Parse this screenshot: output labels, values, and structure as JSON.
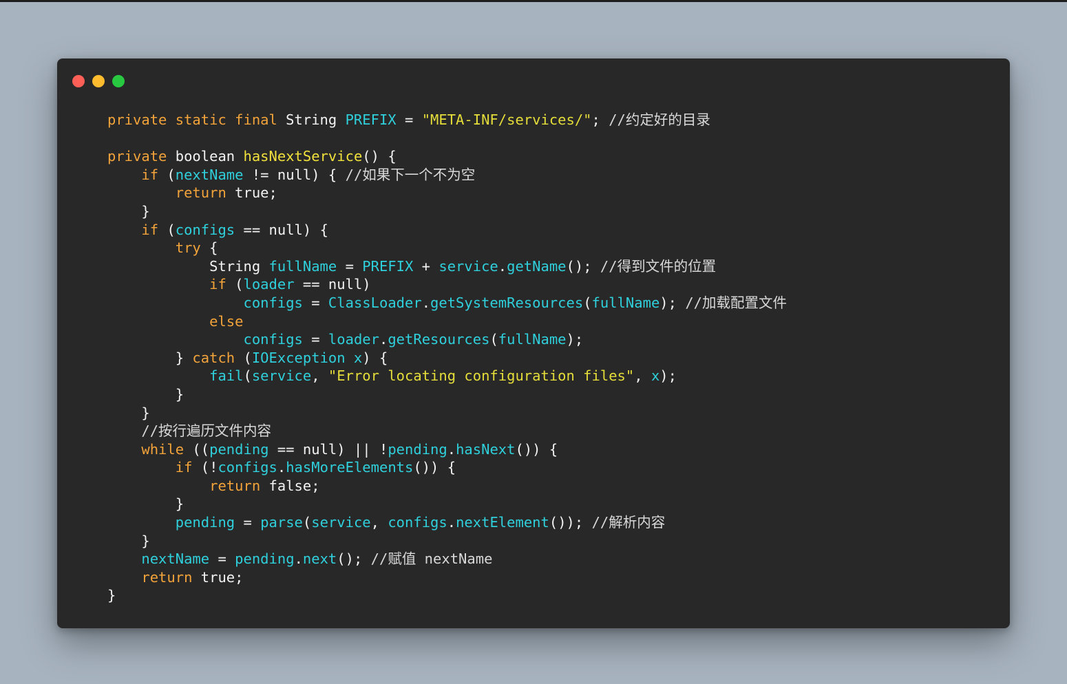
{
  "window": {
    "traffic_lights": {
      "close_color": "#fe5f57",
      "minimize_color": "#febc2e",
      "zoom_color": "#28c840"
    }
  },
  "colors": {
    "background": "#a7b3bf",
    "editor_background": "#282828",
    "keyword": "#f2a33a",
    "identifier": "#2fd0dc",
    "function": "#f2e13c",
    "string": "#e5dd3a",
    "plain": "#f2f2f2"
  },
  "code": {
    "lines": [
      [
        {
          "t": "kw",
          "v": "private static final"
        },
        {
          "t": "pl",
          "v": " String "
        },
        {
          "t": "id",
          "v": "PREFIX"
        },
        {
          "t": "pl",
          "v": " = "
        },
        {
          "t": "str",
          "v": "\"META-INF/services/\""
        },
        {
          "t": "pl",
          "v": "; "
        },
        {
          "t": "cmt",
          "v": "//约定好的目录"
        }
      ],
      [],
      [
        {
          "t": "kw",
          "v": "private"
        },
        {
          "t": "pl",
          "v": " boolean "
        },
        {
          "t": "fn",
          "v": "hasNextService"
        },
        {
          "t": "pl",
          "v": "() {"
        }
      ],
      [
        {
          "t": "pl",
          "v": "    "
        },
        {
          "t": "kw",
          "v": "if"
        },
        {
          "t": "pl",
          "v": " ("
        },
        {
          "t": "id",
          "v": "nextName"
        },
        {
          "t": "pl",
          "v": " != null) { "
        },
        {
          "t": "cmt",
          "v": "//如果下一个不为空"
        }
      ],
      [
        {
          "t": "pl",
          "v": "        "
        },
        {
          "t": "kw",
          "v": "return"
        },
        {
          "t": "pl",
          "v": " true;"
        }
      ],
      [
        {
          "t": "pl",
          "v": "    }"
        }
      ],
      [
        {
          "t": "pl",
          "v": "    "
        },
        {
          "t": "kw",
          "v": "if"
        },
        {
          "t": "pl",
          "v": " ("
        },
        {
          "t": "id",
          "v": "configs"
        },
        {
          "t": "pl",
          "v": " == null) {"
        }
      ],
      [
        {
          "t": "pl",
          "v": "        "
        },
        {
          "t": "kw",
          "v": "try"
        },
        {
          "t": "pl",
          "v": " {"
        }
      ],
      [
        {
          "t": "pl",
          "v": "            String "
        },
        {
          "t": "id",
          "v": "fullName"
        },
        {
          "t": "pl",
          "v": " = "
        },
        {
          "t": "id",
          "v": "PREFIX"
        },
        {
          "t": "pl",
          "v": " + "
        },
        {
          "t": "id",
          "v": "service"
        },
        {
          "t": "pl",
          "v": "."
        },
        {
          "t": "id",
          "v": "getName"
        },
        {
          "t": "pl",
          "v": "(); "
        },
        {
          "t": "cmt",
          "v": "//得到文件的位置"
        }
      ],
      [
        {
          "t": "pl",
          "v": "            "
        },
        {
          "t": "kw",
          "v": "if"
        },
        {
          "t": "pl",
          "v": " ("
        },
        {
          "t": "id",
          "v": "loader"
        },
        {
          "t": "pl",
          "v": " == null)"
        }
      ],
      [
        {
          "t": "pl",
          "v": "                "
        },
        {
          "t": "id",
          "v": "configs"
        },
        {
          "t": "pl",
          "v": " = "
        },
        {
          "t": "id",
          "v": "ClassLoader"
        },
        {
          "t": "pl",
          "v": "."
        },
        {
          "t": "id",
          "v": "getSystemResources"
        },
        {
          "t": "pl",
          "v": "("
        },
        {
          "t": "id",
          "v": "fullName"
        },
        {
          "t": "pl",
          "v": "); "
        },
        {
          "t": "cmt",
          "v": "//加载配置文件"
        }
      ],
      [
        {
          "t": "pl",
          "v": "            "
        },
        {
          "t": "kw",
          "v": "else"
        }
      ],
      [
        {
          "t": "pl",
          "v": "                "
        },
        {
          "t": "id",
          "v": "configs"
        },
        {
          "t": "pl",
          "v": " = "
        },
        {
          "t": "id",
          "v": "loader"
        },
        {
          "t": "pl",
          "v": "."
        },
        {
          "t": "id",
          "v": "getResources"
        },
        {
          "t": "pl",
          "v": "("
        },
        {
          "t": "id",
          "v": "fullName"
        },
        {
          "t": "pl",
          "v": ");"
        }
      ],
      [
        {
          "t": "pl",
          "v": "        } "
        },
        {
          "t": "kw",
          "v": "catch"
        },
        {
          "t": "pl",
          "v": " ("
        },
        {
          "t": "id",
          "v": "IOException x"
        },
        {
          "t": "pl",
          "v": ") {"
        }
      ],
      [
        {
          "t": "pl",
          "v": "            "
        },
        {
          "t": "id",
          "v": "fail"
        },
        {
          "t": "pl",
          "v": "("
        },
        {
          "t": "id",
          "v": "service"
        },
        {
          "t": "pl",
          "v": ", "
        },
        {
          "t": "str",
          "v": "\"Error locating configuration files\""
        },
        {
          "t": "pl",
          "v": ", "
        },
        {
          "t": "id",
          "v": "x"
        },
        {
          "t": "pl",
          "v": ");"
        }
      ],
      [
        {
          "t": "pl",
          "v": "        }"
        }
      ],
      [
        {
          "t": "pl",
          "v": "    }"
        }
      ],
      [
        {
          "t": "pl",
          "v": "    "
        },
        {
          "t": "cmt",
          "v": "//按行遍历文件内容"
        }
      ],
      [
        {
          "t": "pl",
          "v": "    "
        },
        {
          "t": "kw",
          "v": "while"
        },
        {
          "t": "pl",
          "v": " (("
        },
        {
          "t": "id",
          "v": "pending"
        },
        {
          "t": "pl",
          "v": " == null) || !"
        },
        {
          "t": "id",
          "v": "pending"
        },
        {
          "t": "pl",
          "v": "."
        },
        {
          "t": "id",
          "v": "hasNext"
        },
        {
          "t": "pl",
          "v": "()) {"
        }
      ],
      [
        {
          "t": "pl",
          "v": "        "
        },
        {
          "t": "kw",
          "v": "if"
        },
        {
          "t": "pl",
          "v": " (!"
        },
        {
          "t": "id",
          "v": "configs"
        },
        {
          "t": "pl",
          "v": "."
        },
        {
          "t": "id",
          "v": "hasMoreElements"
        },
        {
          "t": "pl",
          "v": "()) {"
        }
      ],
      [
        {
          "t": "pl",
          "v": "            "
        },
        {
          "t": "kw",
          "v": "return"
        },
        {
          "t": "pl",
          "v": " false;"
        }
      ],
      [
        {
          "t": "pl",
          "v": "        }"
        }
      ],
      [
        {
          "t": "pl",
          "v": "        "
        },
        {
          "t": "id",
          "v": "pending"
        },
        {
          "t": "pl",
          "v": " = "
        },
        {
          "t": "id",
          "v": "parse"
        },
        {
          "t": "pl",
          "v": "("
        },
        {
          "t": "id",
          "v": "service"
        },
        {
          "t": "pl",
          "v": ", "
        },
        {
          "t": "id",
          "v": "configs"
        },
        {
          "t": "pl",
          "v": "."
        },
        {
          "t": "id",
          "v": "nextElement"
        },
        {
          "t": "pl",
          "v": "()); "
        },
        {
          "t": "cmt",
          "v": "//解析内容"
        }
      ],
      [
        {
          "t": "pl",
          "v": "    }"
        }
      ],
      [
        {
          "t": "pl",
          "v": "    "
        },
        {
          "t": "id",
          "v": "nextName"
        },
        {
          "t": "pl",
          "v": " = "
        },
        {
          "t": "id",
          "v": "pending"
        },
        {
          "t": "pl",
          "v": "."
        },
        {
          "t": "id",
          "v": "next"
        },
        {
          "t": "pl",
          "v": "(); "
        },
        {
          "t": "cmt",
          "v": "//赋值 nextName"
        }
      ],
      [
        {
          "t": "pl",
          "v": "    "
        },
        {
          "t": "kw",
          "v": "return"
        },
        {
          "t": "pl",
          "v": " true;"
        }
      ],
      [
        {
          "t": "pl",
          "v": "}"
        }
      ]
    ]
  }
}
